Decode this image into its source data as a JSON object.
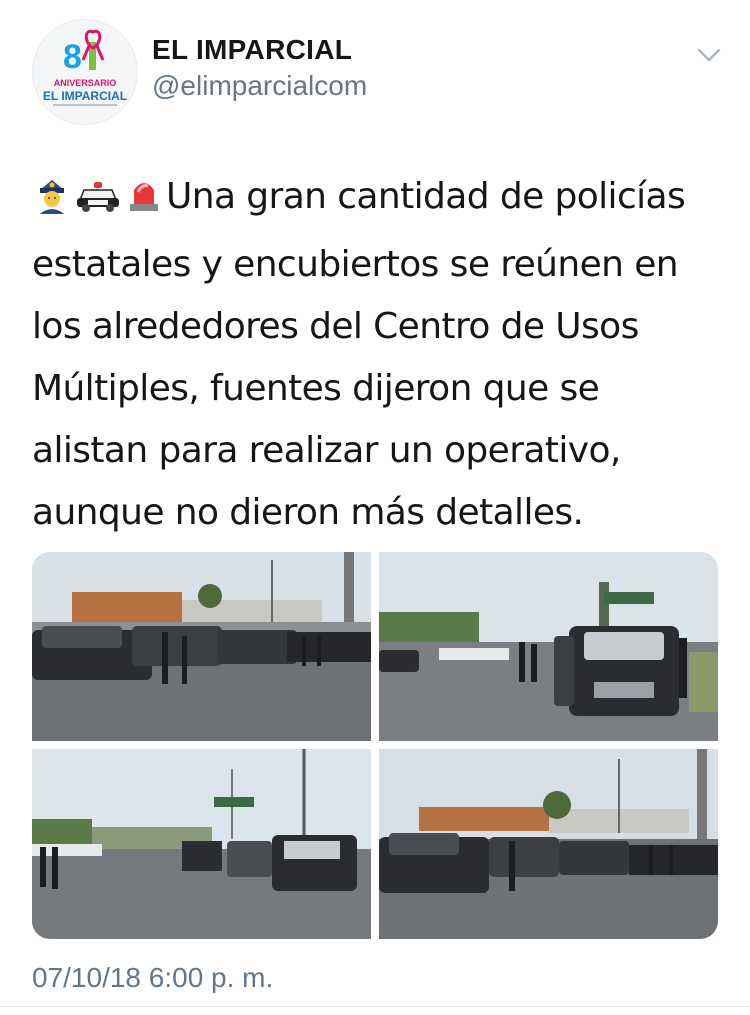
{
  "account": {
    "display_name": "EL IMPARCIAL",
    "handle": "@elimparcialcom",
    "avatar": {
      "number": "81",
      "line1": "ANIVERSARIO",
      "line2": "EL IMPARCIAL"
    }
  },
  "menu_icon": "chevron-down-icon",
  "tweet": {
    "emojis": [
      "police-officer-emoji",
      "police-car-emoji",
      "police-light-emoji"
    ],
    "text": "Una gran cantidad de policías estatales y encubiertos se reúnen en los alrededores del Centro de Usos Múltiples, fuentes dijeron que se alistan para realizar un operativo, aunque no dieron más detalles."
  },
  "media": [
    {
      "name": "photo-police-trucks-parking-lot"
    },
    {
      "name": "photo-police-truck-closeup"
    },
    {
      "name": "photo-officers-line-road"
    },
    {
      "name": "photo-police-trucks-arena"
    }
  ],
  "timestamp": "07/10/18 6:00 p. m.",
  "colors": {
    "text": "#14171a",
    "secondary": "#657786",
    "divider": "#e6ecf0",
    "brand_pink": "#e2136e",
    "brand_blue": "#1aa3e0"
  }
}
